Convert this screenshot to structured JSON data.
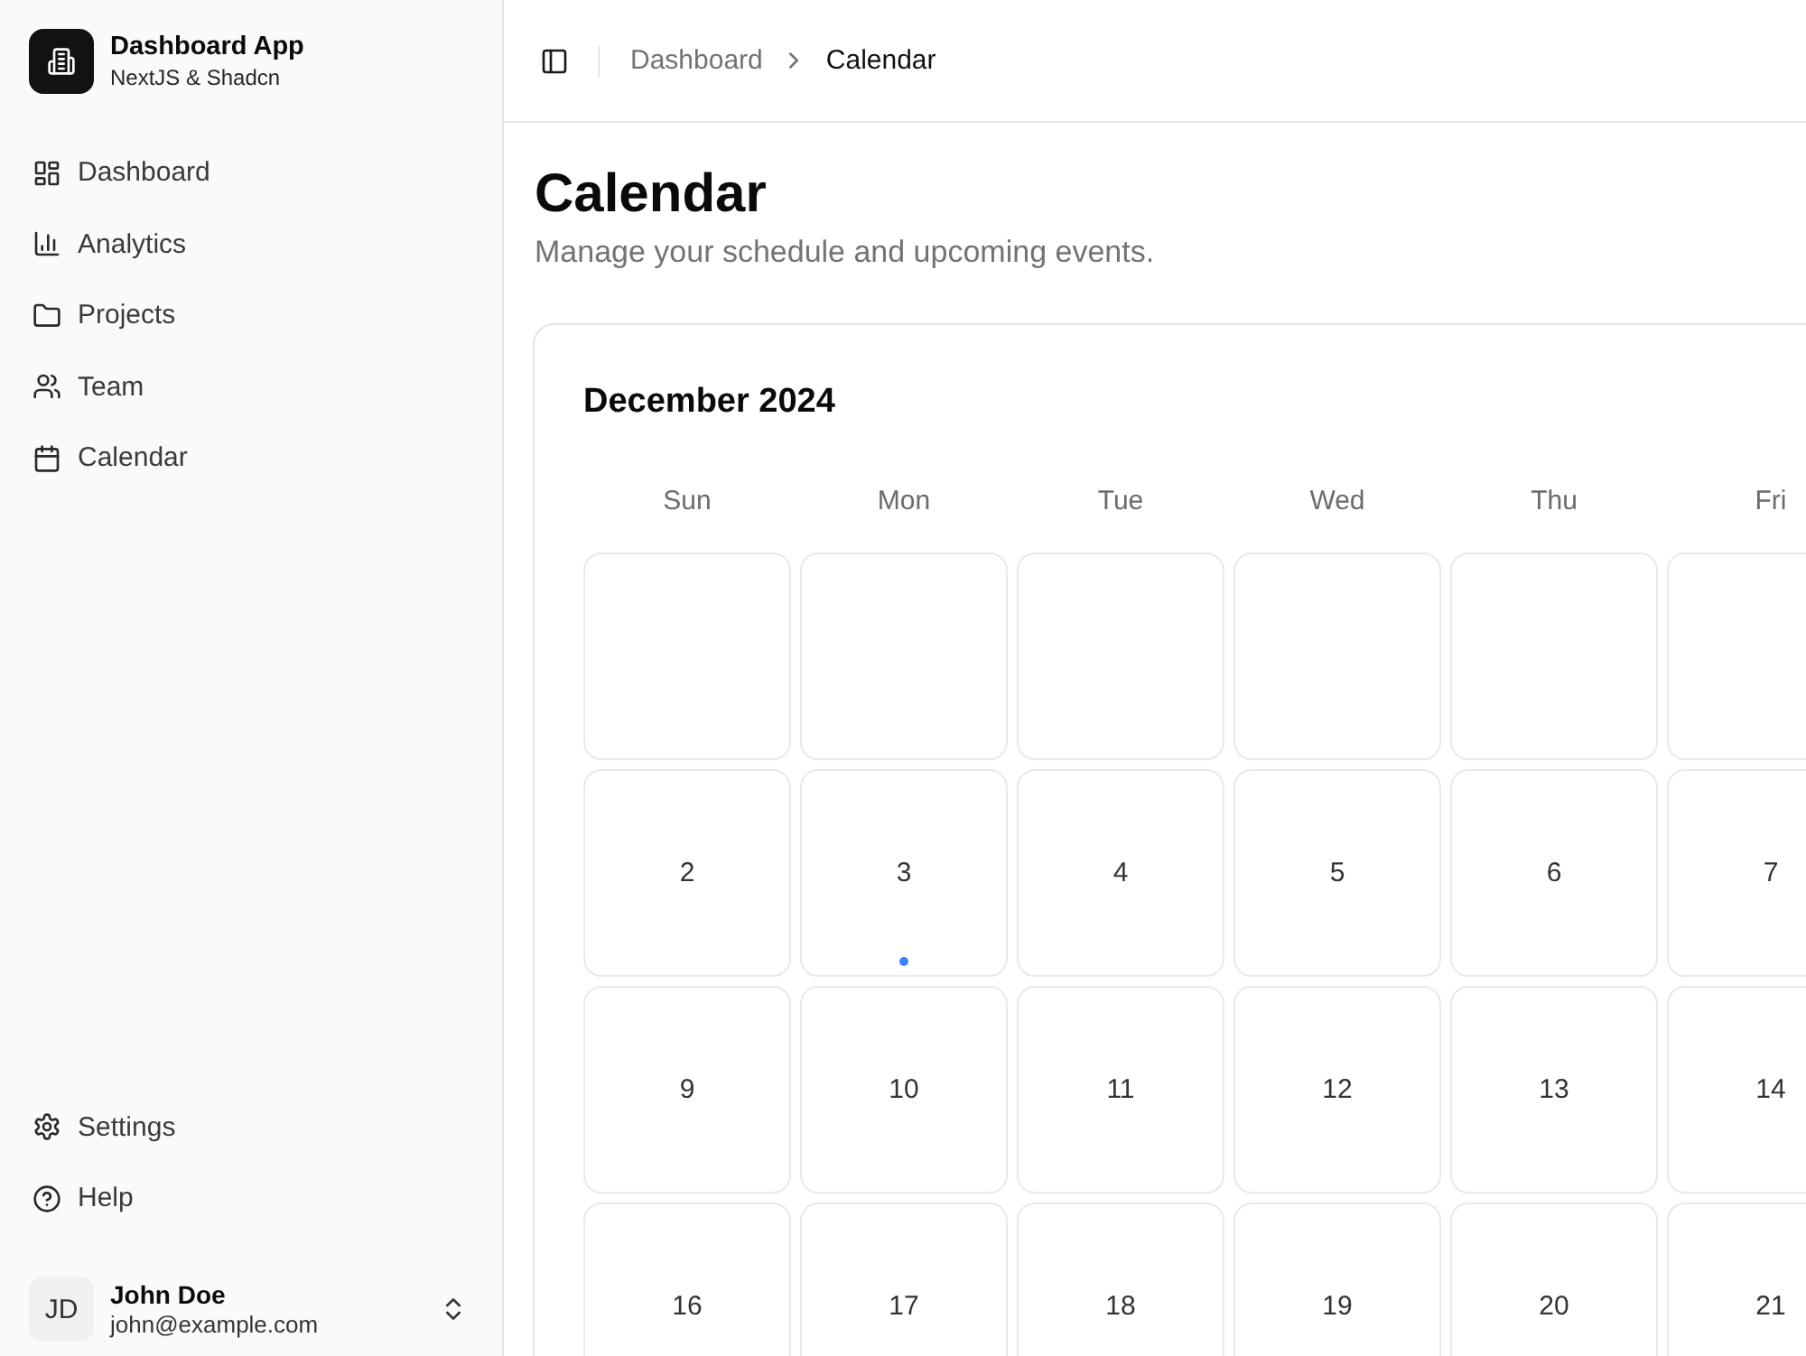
{
  "sidebar": {
    "brand": {
      "title": "Dashboard App",
      "subtitle": "NextJS & Shadcn"
    },
    "nav": [
      {
        "label": "Dashboard"
      },
      {
        "label": "Analytics"
      },
      {
        "label": "Projects"
      },
      {
        "label": "Team"
      },
      {
        "label": "Calendar"
      }
    ],
    "footer_nav": [
      {
        "label": "Settings"
      },
      {
        "label": "Help"
      }
    ],
    "user": {
      "initials": "JD",
      "name": "John Doe",
      "email": "john@example.com"
    }
  },
  "header": {
    "breadcrumb": [
      {
        "label": "Dashboard",
        "current": false
      },
      {
        "label": "Calendar",
        "current": true
      }
    ]
  },
  "page": {
    "title": "Calendar",
    "subtitle": "Manage your schedule and upcoming events."
  },
  "calendar": {
    "month": "December 2024",
    "weekdays": [
      "Sun",
      "Mon",
      "Tue",
      "Wed",
      "Thu",
      "Fri"
    ],
    "weeks": [
      [
        {
          "kind": "empty"
        },
        {
          "kind": "empty"
        },
        {
          "kind": "empty"
        },
        {
          "kind": "empty"
        },
        {
          "kind": "empty"
        },
        {
          "kind": "empty"
        }
      ],
      [
        {
          "kind": "day",
          "label": "2",
          "has_event": false
        },
        {
          "kind": "day",
          "label": "3",
          "has_event": true
        },
        {
          "kind": "day",
          "label": "4",
          "has_event": false
        },
        {
          "kind": "day",
          "label": "5",
          "has_event": false
        },
        {
          "kind": "day",
          "label": "6",
          "has_event": false
        },
        {
          "kind": "day",
          "label": "7",
          "has_event": false
        }
      ],
      [
        {
          "kind": "day",
          "label": "9",
          "has_event": false
        },
        {
          "kind": "day",
          "label": "10",
          "has_event": false
        },
        {
          "kind": "day",
          "label": "11",
          "has_event": false
        },
        {
          "kind": "day",
          "label": "12",
          "has_event": false
        },
        {
          "kind": "day",
          "label": "13",
          "has_event": false
        },
        {
          "kind": "day",
          "label": "14",
          "has_event": false
        }
      ],
      [
        {
          "kind": "day",
          "label": "16"
        },
        {
          "kind": "day",
          "label": "17"
        },
        {
          "kind": "day",
          "label": "18"
        },
        {
          "kind": "day",
          "label": "19"
        },
        {
          "kind": "day",
          "label": "20"
        },
        {
          "kind": "day",
          "label": "21"
        }
      ]
    ]
  }
}
